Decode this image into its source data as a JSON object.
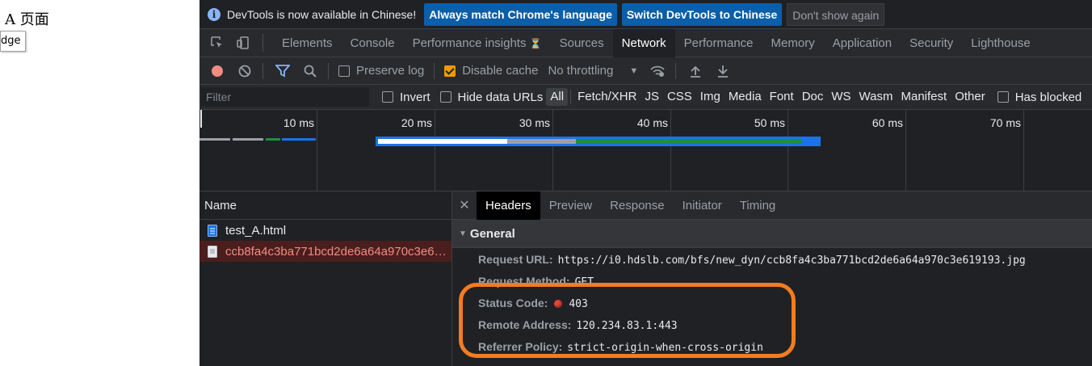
{
  "page": {
    "heading": "A 页面",
    "broken_image_alt": "dge"
  },
  "infobar": {
    "message": "DevTools is now available in Chinese!",
    "btn_match": "Always match Chrome's language",
    "btn_switch": "Switch DevTools to Chinese",
    "btn_dismiss": "Don't show again"
  },
  "tabs": [
    "Elements",
    "Console",
    "Performance insights",
    "Sources",
    "Network",
    "Performance",
    "Memory",
    "Application",
    "Security",
    "Lighthouse"
  ],
  "toolbar": {
    "preserve_log": "Preserve log",
    "disable_cache": "Disable cache",
    "throttling": "No throttling"
  },
  "filterbar": {
    "placeholder": "Filter",
    "invert": "Invert",
    "hide_data_urls": "Hide data URLs",
    "types": [
      "All",
      "Fetch/XHR",
      "JS",
      "CSS",
      "Img",
      "Media",
      "Font",
      "Doc",
      "WS",
      "Wasm",
      "Manifest",
      "Other"
    ],
    "has_blocked": "Has blocked"
  },
  "timeline": {
    "ticks": [
      "10 ms",
      "20 ms",
      "30 ms",
      "40 ms",
      "50 ms",
      "60 ms",
      "70 ms"
    ]
  },
  "requests": {
    "header": "Name",
    "items": [
      {
        "name": "test_A.html",
        "failed": false
      },
      {
        "name": "ccb8fa4c3ba771bcd2de6a64a970c3e619193.jpg",
        "failed": true
      }
    ]
  },
  "detail": {
    "tabs": [
      "Headers",
      "Preview",
      "Response",
      "Initiator",
      "Timing"
    ],
    "section": "General",
    "request_url_label": "Request URL:",
    "request_url": "https://i0.hdslb.com/bfs/new_dyn/ccb8fa4c3ba771bcd2de6a64a970c3e619193.jpg",
    "request_method_label": "Request Method:",
    "request_method": "GET",
    "status_code_label": "Status Code:",
    "status_code": "403",
    "remote_address_label": "Remote Address:",
    "remote_address": "120.234.83.1:443",
    "referrer_policy_label": "Referrer Policy:",
    "referrer_policy": "strict-origin-when-cross-origin"
  },
  "colors": {
    "accent": "#f29900",
    "highlight": "#f47c20",
    "error": "#ea4335",
    "primary_button": "#0b5ea8"
  }
}
